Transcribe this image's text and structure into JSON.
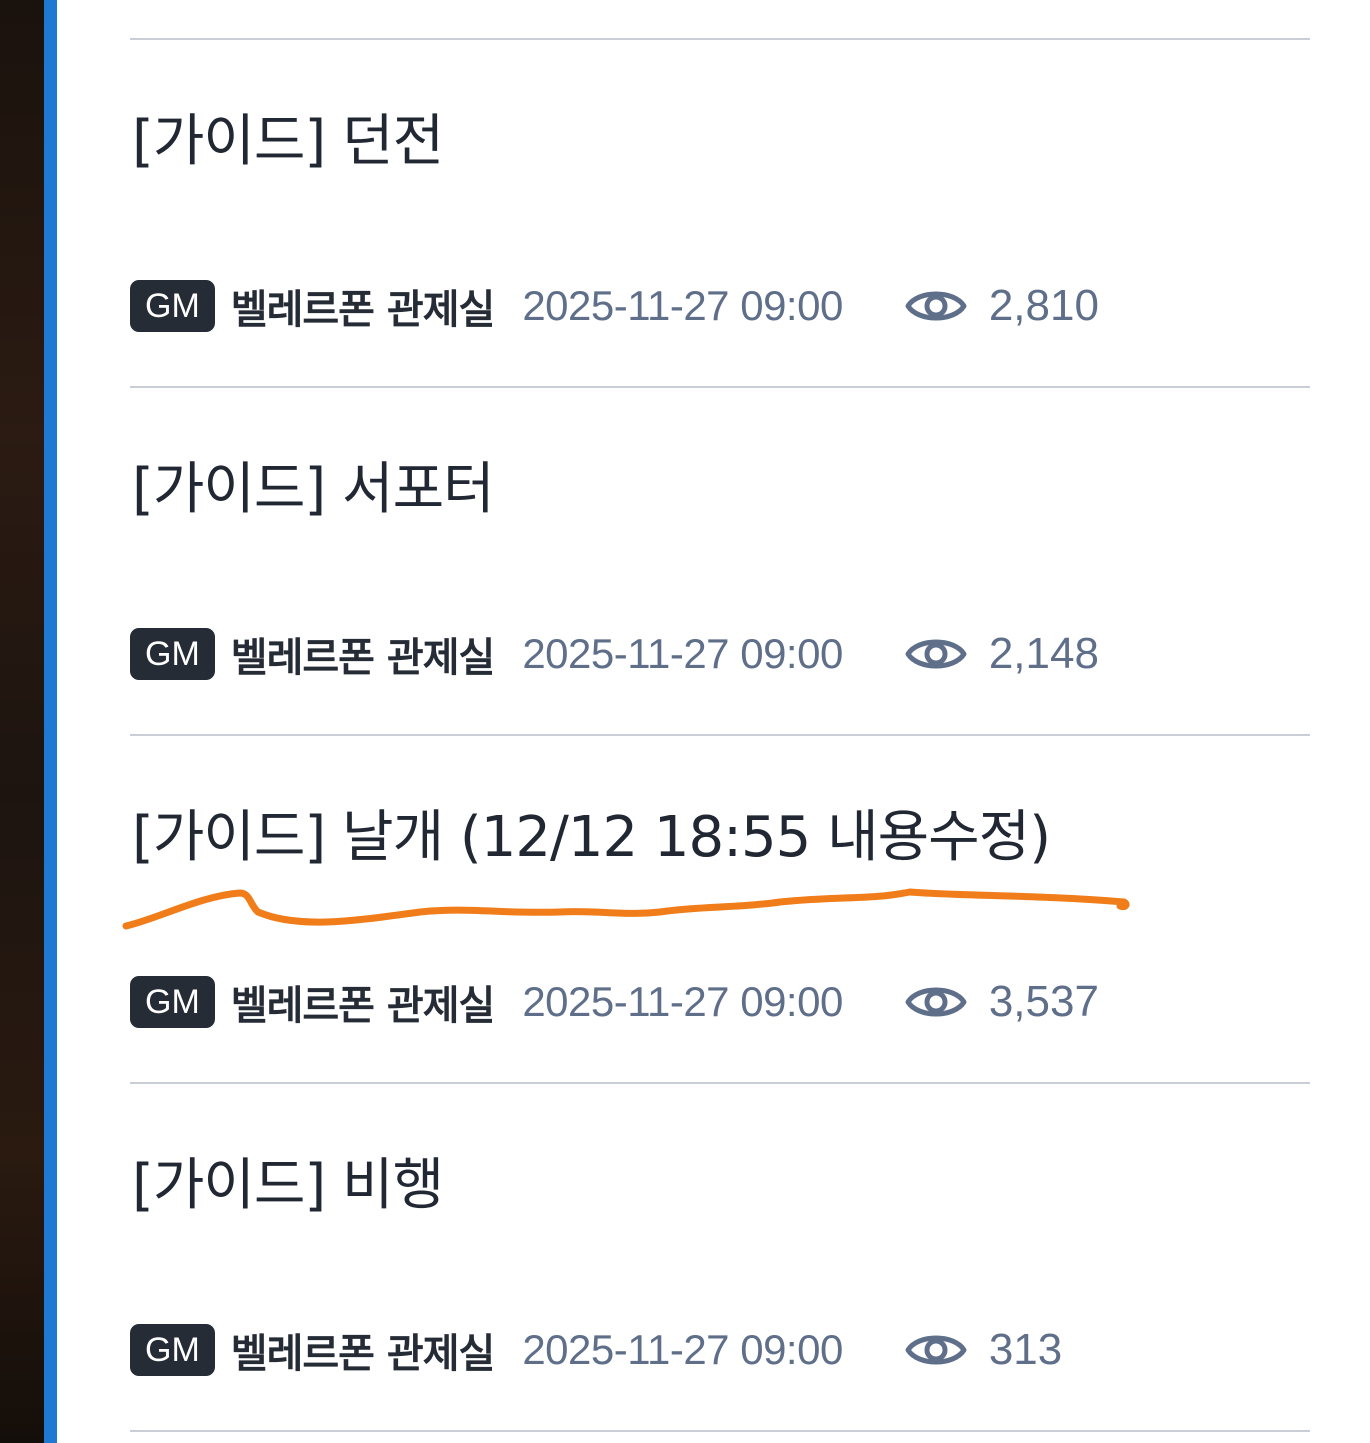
{
  "posts": [
    {
      "title": "[가이드] 던전",
      "badge": "GM",
      "author": "벨레르폰 관제실",
      "date": "2025-11-27 09:00",
      "views": "2,810"
    },
    {
      "title": "[가이드] 서포터",
      "badge": "GM",
      "author": "벨레르폰 관제실",
      "date": "2025-11-27 09:00",
      "views": "2,148"
    },
    {
      "title": "[가이드] 날개 (12/12 18:55 내용수정)",
      "badge": "GM",
      "author": "벨레르폰 관제실",
      "date": "2025-11-27 09:00",
      "views": "3,537"
    },
    {
      "title": "[가이드] 비행",
      "badge": "GM",
      "author": "벨레르폰 관제실",
      "date": "2025-11-27 09:00",
      "views": "313"
    }
  ],
  "icons": {
    "views": "eye-icon"
  },
  "colors": {
    "accent_bar": "#1f78d1",
    "badge_bg": "#262c36",
    "meta_text": "#5f6f8a",
    "divider": "#c9ced8",
    "annotation_underline": "#f07d1a"
  }
}
